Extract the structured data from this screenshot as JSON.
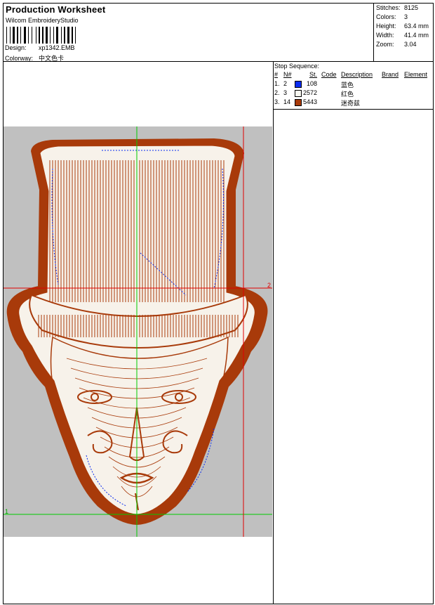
{
  "header": {
    "title": "Production Worksheet",
    "company": "Wilcom EmbroideryStudio",
    "design_label": "Design:",
    "design_value": "xp1342.EMB",
    "colorway_label": "Colorway:",
    "colorway_value": "中文色卡"
  },
  "stats": [
    {
      "label": "Stitches:",
      "value": "8125"
    },
    {
      "label": "Colors:",
      "value": "3"
    },
    {
      "label": "Height:",
      "value": "63.4 mm"
    },
    {
      "label": "Width:",
      "value": "41.4 mm"
    },
    {
      "label": "Zoom:",
      "value": "3.04"
    }
  ],
  "stop_sequence": {
    "title": "Stop Sequence:",
    "columns": [
      "#",
      "N#",
      "St.",
      "Code",
      "Description",
      "Brand",
      "Element"
    ],
    "rows": [
      {
        "num": "1.",
        "needle": "2",
        "code": "108",
        "description": "蓝色",
        "color": "#0a2cf0"
      },
      {
        "num": "2.",
        "needle": "3",
        "code": "2572",
        "description": "红色",
        "color": "#f7f7f0"
      },
      {
        "num": "3.",
        "needle": "14",
        "code": "5443",
        "description": "迷奇兹",
        "color": "#a83a0a"
      }
    ]
  },
  "design_view": {
    "guide_labels": [
      "2",
      "1"
    ],
    "colors": {
      "background": "#c0c0c0",
      "thread_brown": "#a83a0a",
      "thread_blue": "#0a2cf0",
      "guide_green": "#00cc00",
      "guide_red": "#e00000"
    }
  }
}
